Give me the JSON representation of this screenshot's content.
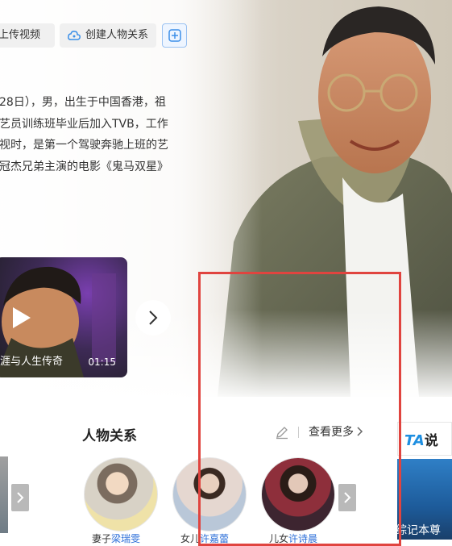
{
  "actions": {
    "upload_video": "上传视频",
    "create_relation": "创建人物关系"
  },
  "summary": {
    "lines": [
      "28日），男，出生于中国香港，祖",
      "艺员训练班毕业后加入TVB，工作",
      "视时，是第一个驾驶奔驰上班的艺",
      "冠杰兄弟主演的电影《鬼马双星》"
    ]
  },
  "video": {
    "title": "涯与人生传奇",
    "duration": "01:15"
  },
  "relations": {
    "title": "人物关系",
    "more": "查看更多",
    "items": [
      {
        "role": "妻子",
        "name": "梁瑞雯"
      },
      {
        "role": "女儿",
        "name": "许嘉蕾"
      },
      {
        "role": "儿女",
        "name": "许诗晨"
      }
    ]
  },
  "ta_panel": {
    "logo_ta": "TA",
    "logo_shuo": "说",
    "caption": "综记本尊"
  },
  "colors": {
    "accent": "#2b6ed8",
    "highlight_frame": "#e0443f"
  }
}
